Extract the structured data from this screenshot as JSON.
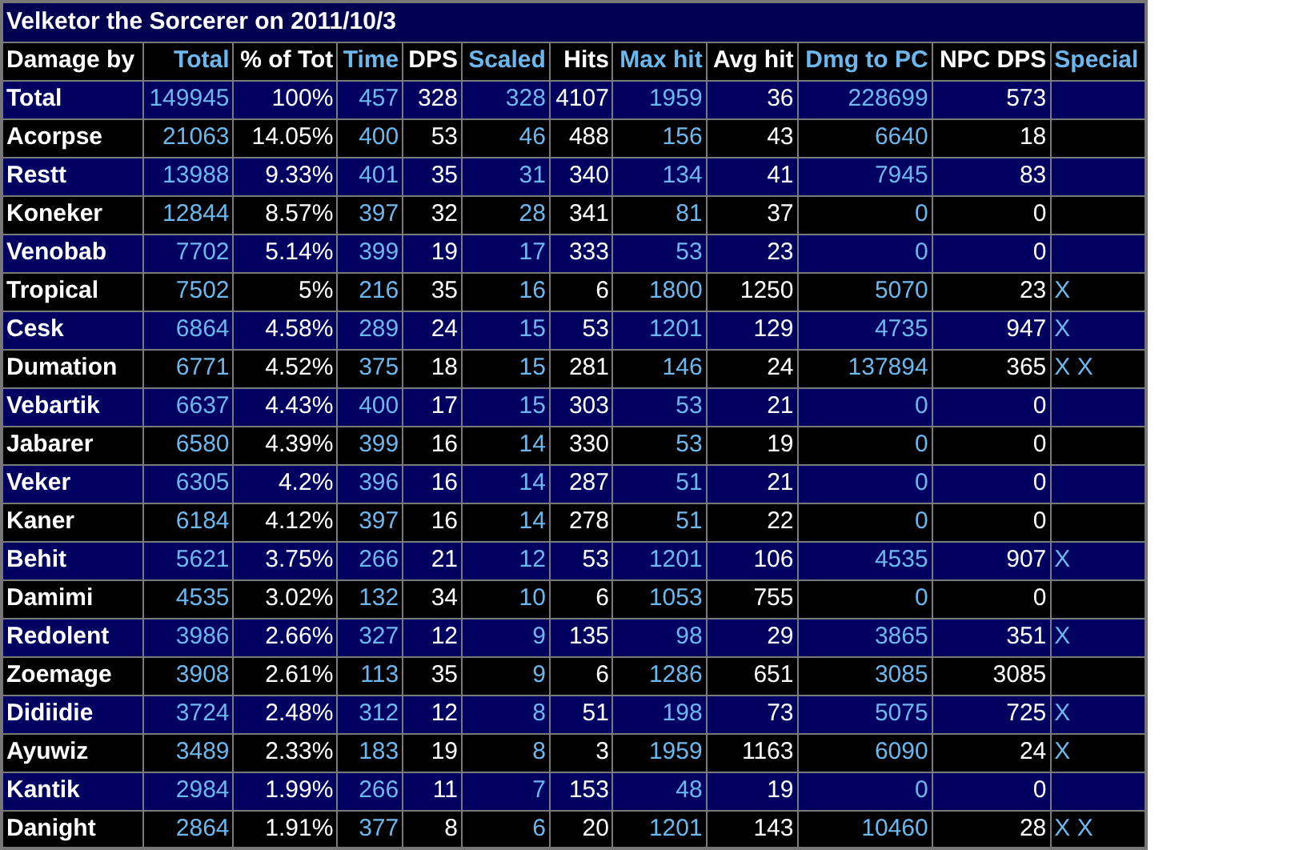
{
  "title": "Velketor the Sorcerer on 2011/10/3",
  "columns": [
    {
      "label": "Damage by",
      "link": false
    },
    {
      "label": "Total",
      "link": true
    },
    {
      "label": "% of Tot",
      "link": false
    },
    {
      "label": "Time",
      "link": true
    },
    {
      "label": "DPS",
      "link": false
    },
    {
      "label": "Scaled",
      "link": true
    },
    {
      "label": "Hits",
      "link": false
    },
    {
      "label": "Max hit",
      "link": true
    },
    {
      "label": "Avg hit",
      "link": false
    },
    {
      "label": "Dmg to PC",
      "link": true
    },
    {
      "label": "NPC DPS",
      "link": false
    },
    {
      "label": "Special",
      "link": true
    }
  ],
  "rows": [
    {
      "name": "Total",
      "cells": [
        "149945",
        "100%",
        "457",
        "328",
        "328",
        "4107",
        "1959",
        "36",
        "228699",
        "573"
      ]
    },
    {
      "name": "Acorpse",
      "cells": [
        "21063",
        "14.05%",
        "400",
        "53",
        "46",
        "488",
        "156",
        "43",
        "6640",
        "18"
      ]
    },
    {
      "name": "Restt",
      "cells": [
        "13988",
        "9.33%",
        "401",
        "35",
        "31",
        "340",
        "134",
        "41",
        "7945",
        "83"
      ]
    },
    {
      "name": "Koneker",
      "cells": [
        "12844",
        "8.57%",
        "397",
        "32",
        "28",
        "341",
        "81",
        "37",
        "0",
        "0"
      ]
    },
    {
      "name": "Venobab",
      "cells": [
        "7702",
        "5.14%",
        "399",
        "19",
        "17",
        "333",
        "53",
        "23",
        "0",
        "0"
      ]
    },
    {
      "name": "Tropical",
      "cells": [
        "7502",
        "5%",
        "216",
        "35",
        "16",
        "6",
        "1800",
        "1250",
        "5070",
        "23"
      ],
      "special": "X"
    },
    {
      "name": "Cesk",
      "cells": [
        "6864",
        "4.58%",
        "289",
        "24",
        "15",
        "53",
        "1201",
        "129",
        "4735",
        "947"
      ],
      "special": "X"
    },
    {
      "name": "Dumation",
      "cells": [
        "6771",
        "4.52%",
        "375",
        "18",
        "15",
        "281",
        "146",
        "24",
        "137894",
        "365"
      ],
      "special": "X X"
    },
    {
      "name": "Vebartik",
      "cells": [
        "6637",
        "4.43%",
        "400",
        "17",
        "15",
        "303",
        "53",
        "21",
        "0",
        "0"
      ]
    },
    {
      "name": "Jabarer",
      "cells": [
        "6580",
        "4.39%",
        "399",
        "16",
        "14",
        "330",
        "53",
        "19",
        "0",
        "0"
      ]
    },
    {
      "name": "Veker",
      "cells": [
        "6305",
        "4.2%",
        "396",
        "16",
        "14",
        "287",
        "51",
        "21",
        "0",
        "0"
      ]
    },
    {
      "name": "Kaner",
      "cells": [
        "6184",
        "4.12%",
        "397",
        "16",
        "14",
        "278",
        "51",
        "22",
        "0",
        "0"
      ]
    },
    {
      "name": "Behit",
      "cells": [
        "5621",
        "3.75%",
        "266",
        "21",
        "12",
        "53",
        "1201",
        "106",
        "4535",
        "907"
      ],
      "special": "X"
    },
    {
      "name": "Damimi",
      "cells": [
        "4535",
        "3.02%",
        "132",
        "34",
        "10",
        "6",
        "1053",
        "755",
        "0",
        "0"
      ]
    },
    {
      "name": "Redolent",
      "cells": [
        "3986",
        "2.66%",
        "327",
        "12",
        "9",
        "135",
        "98",
        "29",
        "3865",
        "351"
      ],
      "special": "X"
    },
    {
      "name": "Zoemage",
      "cells": [
        "3908",
        "2.61%",
        "113",
        "35",
        "9",
        "6",
        "1286",
        "651",
        "3085",
        "3085"
      ]
    },
    {
      "name": "Didiidie",
      "cells": [
        "3724",
        "2.48%",
        "312",
        "12",
        "8",
        "51",
        "198",
        "73",
        "5075",
        "725"
      ],
      "special": "X"
    },
    {
      "name": "Ayuwiz",
      "cells": [
        "3489",
        "2.33%",
        "183",
        "19",
        "8",
        "3",
        "1959",
        "1163",
        "6090",
        "24"
      ],
      "special": "X"
    },
    {
      "name": "Kantik",
      "cells": [
        "2984",
        "1.99%",
        "266",
        "11",
        "7",
        "153",
        "48",
        "19",
        "0",
        "0"
      ]
    },
    {
      "name": "Danight",
      "cells": [
        "2864",
        "1.91%",
        "377",
        "8",
        "6",
        "20",
        "1201",
        "143",
        "10460",
        "28"
      ],
      "special": "X X"
    }
  ]
}
